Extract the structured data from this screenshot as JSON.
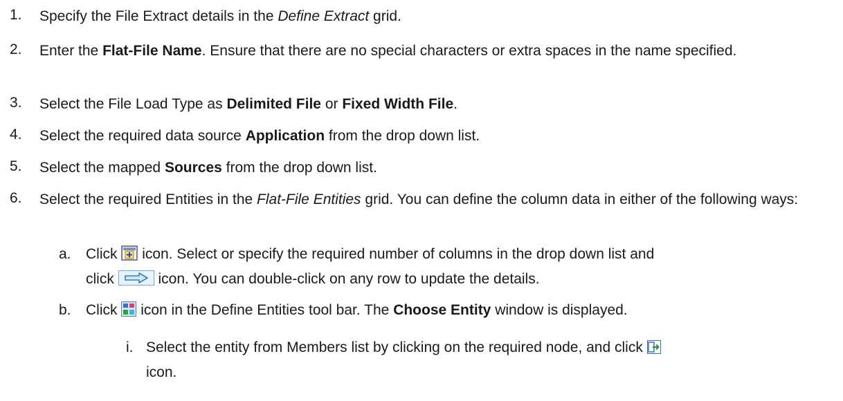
{
  "steps": [
    {
      "num": "1.",
      "parts": [
        "Specify the File Extract details in the ",
        "Define Extract",
        " grid."
      ]
    },
    {
      "num": "2.",
      "parts": [
        "Enter the ",
        "Flat-File Name",
        ". Ensure that there are no special characters or extra spaces in the name specified."
      ]
    },
    {
      "num": "3.",
      "parts": [
        "Select the File Load Type as ",
        "Delimited File",
        " or ",
        "Fixed Width File",
        "."
      ]
    },
    {
      "num": "4.",
      "parts": [
        "Select the required data source ",
        "Application",
        " from the drop down list."
      ]
    },
    {
      "num": "5.",
      "parts": [
        "Select the mapped ",
        "Sources",
        " from the drop down list."
      ]
    },
    {
      "num": "6.",
      "parts": [
        "Select the required Entities in the ",
        "Flat-File Entities",
        " grid. You can define the column data in either of the following ways:"
      ]
    }
  ],
  "substeps": [
    {
      "num": "a.",
      "parts": [
        "Click ",
        "icon. Select or specify the required number of columns in the drop down list and",
        "click ",
        "icon. You can double-click on any row to update the details."
      ]
    },
    {
      "num": "b.",
      "parts": [
        "Click ",
        "icon in the Define Entities tool bar. The ",
        "Choose Entity",
        " window is displayed."
      ]
    }
  ],
  "roman": [
    {
      "num": "i.",
      "parts": [
        "Select the entity from Members list by clicking on the required node, and click ",
        "icon."
      ]
    }
  ],
  "icons": {
    "add_columns": "add-columns-icon",
    "arrow": "right-arrow-icon",
    "define_entities": "define-entities-icon",
    "select": "select-icon"
  }
}
